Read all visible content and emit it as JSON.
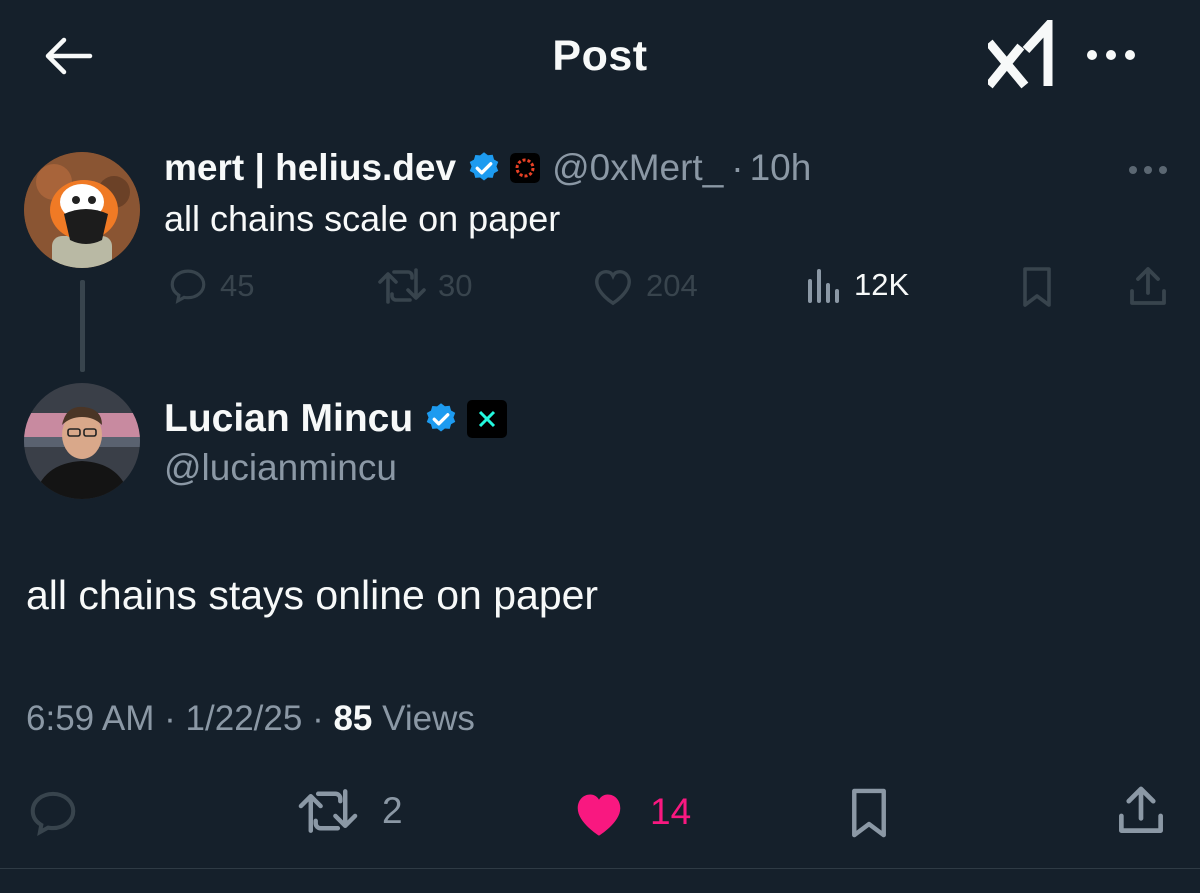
{
  "header": {
    "title": "Post"
  },
  "parent_post": {
    "display_name": "mert | helius.dev",
    "handle": "@0xMert_",
    "separator": "·",
    "time_ago": "10h",
    "text": "all chains scale on paper",
    "stats": {
      "replies": "45",
      "reposts": "30",
      "likes": "204",
      "views": "12K"
    }
  },
  "main_post": {
    "display_name": "Lucian Mincu",
    "handle": "@lucianmincu",
    "text": "all chains stays online on paper",
    "time": "6:59 AM",
    "date": "1/22/25",
    "separator": "·",
    "views_count": "85",
    "views_label": "Views",
    "stats": {
      "reposts": "2",
      "likes": "14"
    }
  },
  "colors": {
    "background": "#15202b",
    "text_primary": "#f7f9f9",
    "text_secondary": "#8b98a5",
    "icon_muted": "#38444d",
    "verified": "#1d9bf0",
    "like_active": "#f91880"
  },
  "icons": {
    "back": "arrow-left-icon",
    "grok": "grok-icon",
    "more": "more-dots-icon",
    "reply": "reply-icon",
    "repost": "repost-icon",
    "like": "heart-icon",
    "views": "views-icon",
    "bookmark": "bookmark-icon",
    "share": "share-icon",
    "verified": "verified-badge-icon"
  }
}
